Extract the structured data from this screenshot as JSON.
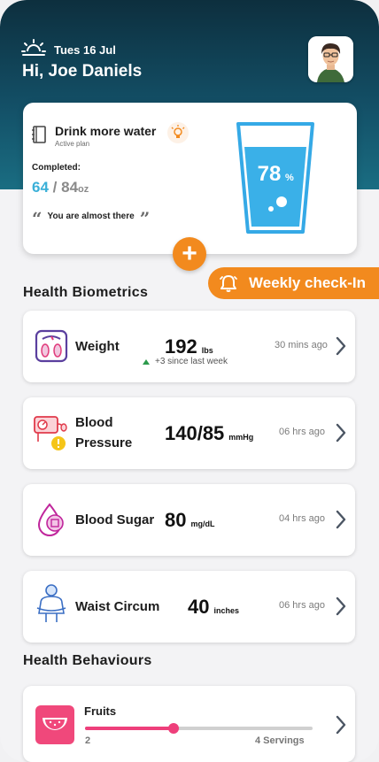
{
  "header": {
    "date": "Tues 16 Jul",
    "greeting": "Hi, Joe Daniels",
    "icon": "sunrise-icon",
    "colors": {
      "top": "#0d2f3e",
      "bottom": "#1a6d82"
    }
  },
  "water_card": {
    "title": "Drink more water",
    "subtitle": "Active plan",
    "completed_label": "Completed:",
    "current": "64",
    "separator": "/",
    "target": "84",
    "unit": "oz",
    "percent": "78",
    "percent_sign": "%",
    "quote": "You are almost there",
    "quote_open": "“",
    "quote_close": "”",
    "accent": "#3ab0d8"
  },
  "actions": {
    "add_symbol": "+",
    "checkin_label": "Weekly check-In",
    "accent": "#f28a1e"
  },
  "biometrics": {
    "title": "Health Biometrics",
    "items": [
      {
        "name": "Weight",
        "value": "192",
        "unit": "lbs",
        "delta": "+3 since last week",
        "time": "30 mins ago",
        "icon": "scale-icon"
      },
      {
        "name_line1": "Blood",
        "name_line2": "Pressure",
        "value": "140/85",
        "unit": "mmHg",
        "time": "06 hrs ago",
        "icon": "blood-pressure-icon"
      },
      {
        "name": "Blood Sugar",
        "value": "80",
        "unit": "mg/dL",
        "time": "04 hrs ago",
        "icon": "blood-drop-icon"
      },
      {
        "name": "Waist Circum",
        "value": "40",
        "unit": "inches",
        "time": "06 hrs ago",
        "icon": "waist-icon"
      }
    ]
  },
  "behaviours": {
    "title": "Health Behaviours",
    "items": [
      {
        "name": "Fruits",
        "current": "2",
        "goal_label": "4 Servings",
        "progress": 0.39,
        "icon": "watermelon-icon",
        "color": "#ee3f7b"
      }
    ]
  }
}
